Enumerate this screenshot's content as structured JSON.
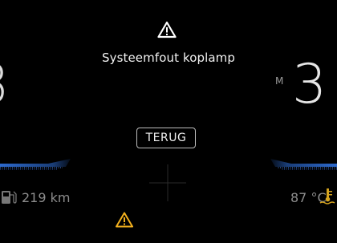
{
  "warning": {
    "message": "Systeemfout koplamp"
  },
  "speed": {
    "partial_digit": "8"
  },
  "gear": {
    "mode": "M",
    "value": "3"
  },
  "controls": {
    "back_label": "TERUG"
  },
  "fuel": {
    "range": "219 km"
  },
  "engine": {
    "temperature": "87 °C"
  },
  "colors": {
    "warning_white": "#ffffff",
    "warning_amber": "#f2b01e",
    "gauge_blue": "#2f6fd8"
  },
  "icons": {
    "top": "warning-triangle-icon",
    "bottom": "amber-warning-triangle-icon",
    "fuel": "fuel-pump-icon",
    "temperature": "coolant-temperature-icon"
  }
}
